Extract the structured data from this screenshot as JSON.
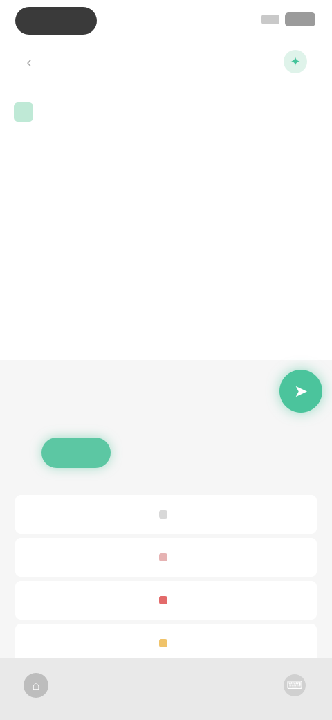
{
  "header": {
    "back_icon": "back-arrow-icon",
    "title": "",
    "action_icon": "sparkle-icon"
  },
  "note": {
    "text": "",
    "subtext": ""
  },
  "composer": {
    "placeholder": "",
    "send_icon": "send-arrow-icon"
  },
  "tabs": [
    {
      "label": ""
    },
    {
      "label": ""
    },
    {
      "label": ""
    },
    {
      "label": ""
    },
    {
      "label": ""
    }
  ],
  "suggestions": [
    {
      "label": "",
      "color": "#d8d8d8"
    },
    {
      "label": "",
      "color": "#e6b3b3"
    },
    {
      "label": "",
      "color": "#e36a6a"
    },
    {
      "label": "",
      "color": "#f0c36a"
    }
  ],
  "colors": {
    "accent": "#4bc49c",
    "tab_active": "#5cc7a3"
  }
}
